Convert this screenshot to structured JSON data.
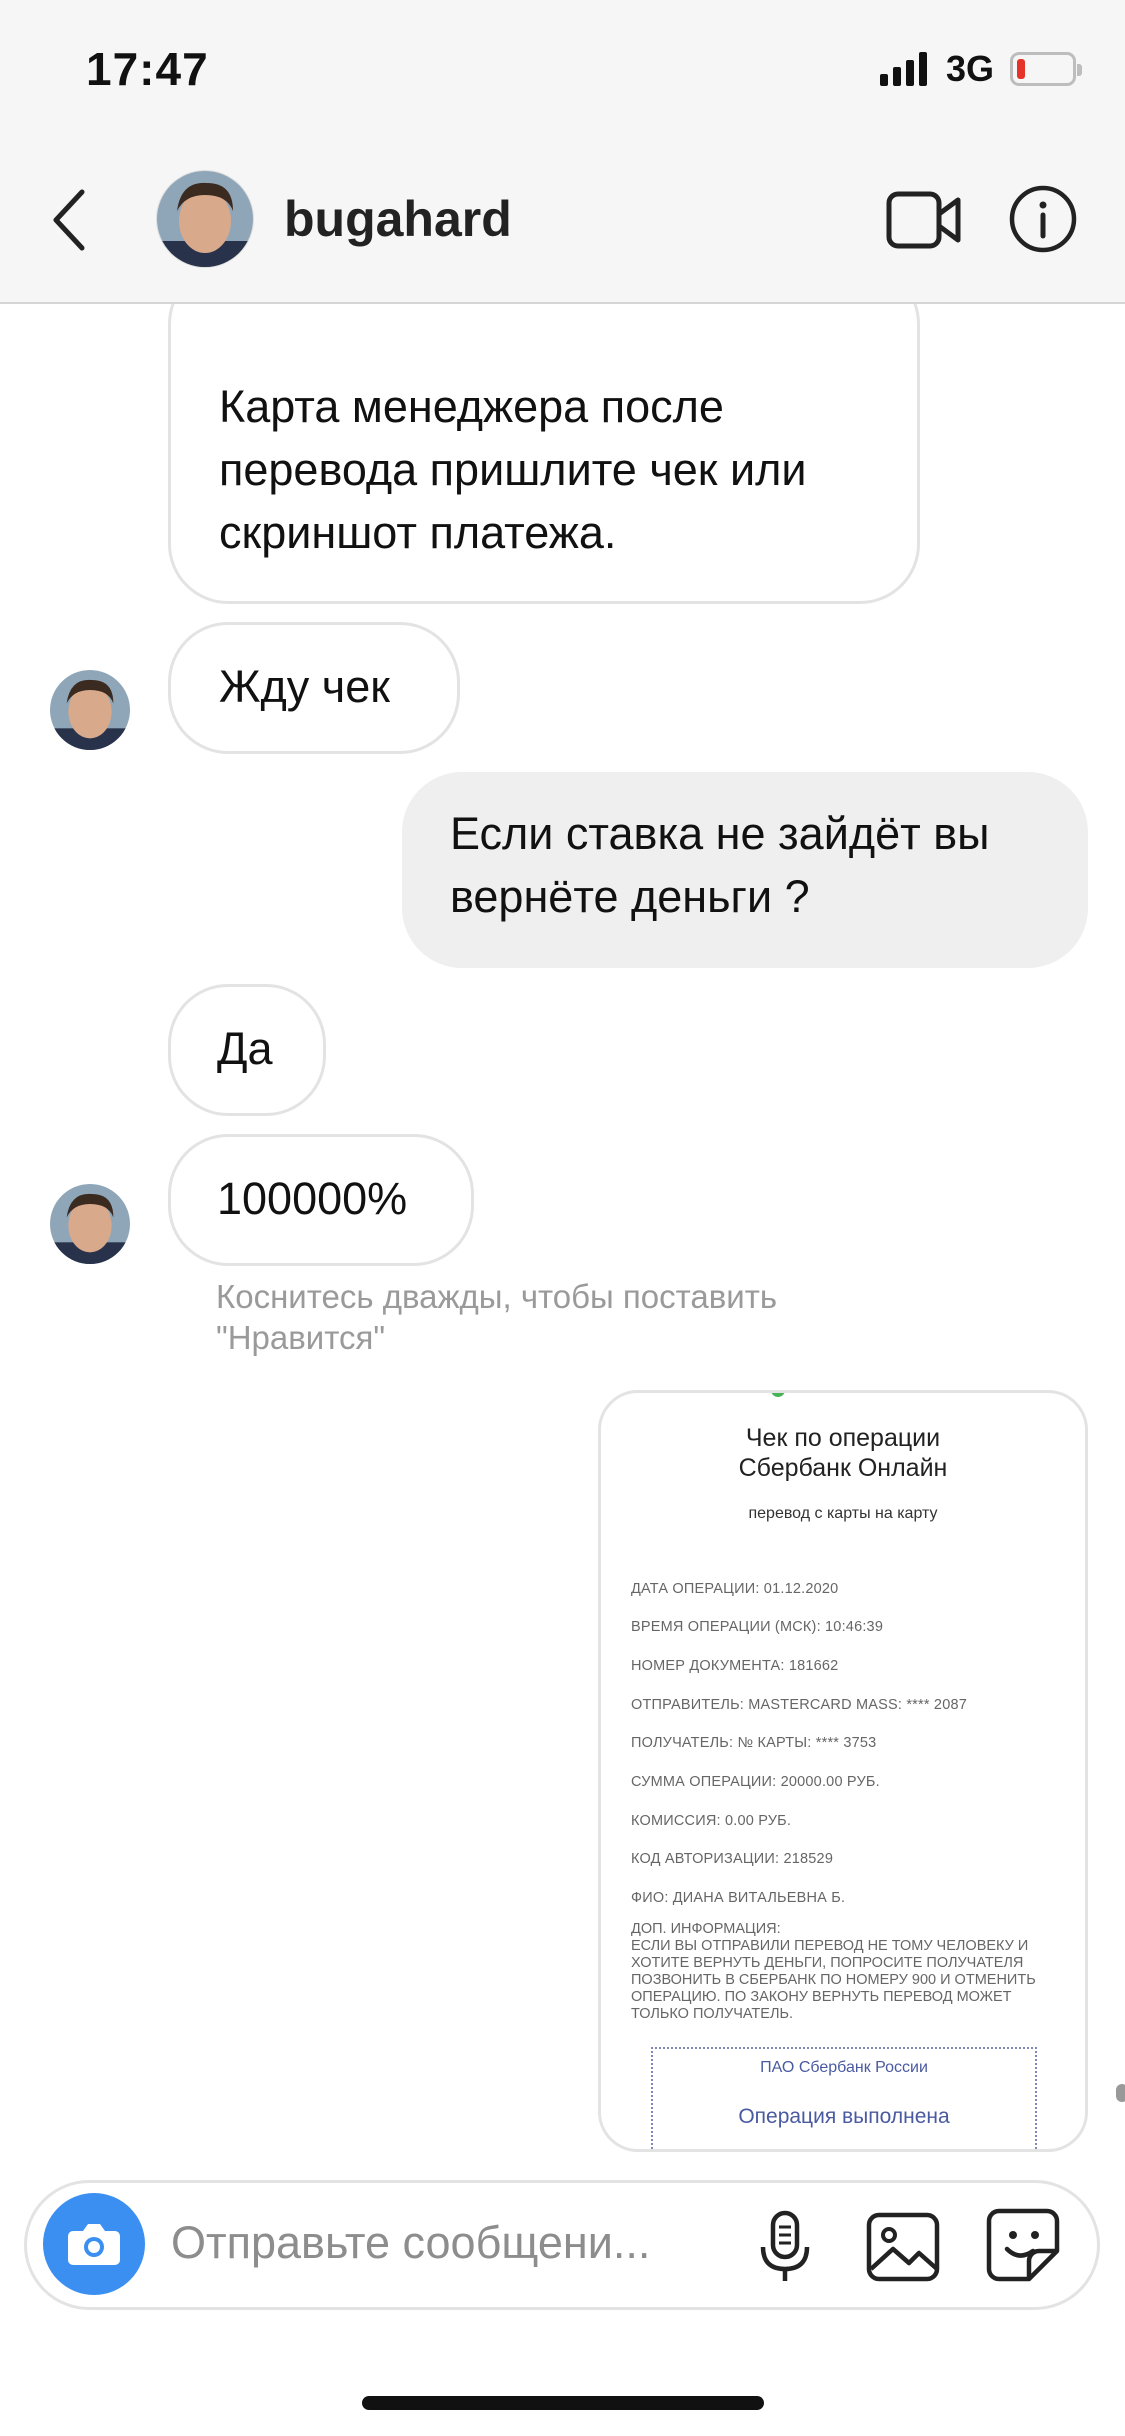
{
  "status_bar": {
    "time": "17:47",
    "network": "3G",
    "battery_level": "low",
    "battery_color": "#e6332a"
  },
  "header": {
    "username": "bugahard",
    "back_icon": "chevron-left-icon",
    "video_icon": "video-camera-icon",
    "info_icon": "info-icon"
  },
  "messages": [
    {
      "direction": "in",
      "text_lines": [
        "Карта менеджера после",
        "перевода пришлите чек или",
        "скриншот платежа."
      ]
    },
    {
      "direction": "in",
      "text": "Жду чек"
    },
    {
      "direction": "out",
      "text_lines": [
        "Если ставка не зайдёт вы",
        "вернёте деньги ?"
      ]
    },
    {
      "direction": "in",
      "text": "Да"
    },
    {
      "direction": "in",
      "text": "100000%"
    }
  ],
  "like_hint": "Коснитесь дважды, чтобы поставить \"Нравится\"",
  "receipt": {
    "title_line1": "Чек по операции",
    "title_line2": "Сбербанк Онлайн",
    "subtitle": "перевод с карты на карту",
    "lines": [
      "ДАТА ОПЕРАЦИИ: 01.12.2020",
      "ВРЕМЯ ОПЕРАЦИИ (МСК): 10:46:39",
      "НОМЕР ДОКУМЕНТА: 181662",
      "ОТПРАВИТЕЛЬ: MASTERCARD MASS: **** 2087",
      "ПОЛУЧАТЕЛЬ: № КАРТЫ: **** 3753",
      "СУММА ОПЕРАЦИИ: 20000.00 РУБ.",
      "КОМИССИЯ: 0.00 РУБ.",
      "КОД АВТОРИЗАЦИИ: 218529",
      "ФИО: ДИАНА ВИТАЛЬЕВНА Б."
    ],
    "note_title": "ДОП. ИНФОРМАЦИЯ:",
    "note_text": "ЕСЛИ ВЫ ОТПРАВИЛИ ПЕРЕВОД НЕ ТОМУ ЧЕЛОВЕКУ И ХОТИТЕ ВЕРНУТЬ ДЕНЬГИ, ПОПРОСИТЕ ПОЛУЧАТЕЛЯ ПОЗВОНИТЬ В СБЕРБАНК ПО НОМЕРУ 900 И ОТМЕНИТЬ ОПЕРАЦИЮ. ПО ЗАКОНУ ВЕРНУТЬ ПЕРЕВОД МОЖЕТ ТОЛЬКО ПОЛУЧАТЕЛЬ.",
    "bank": "ПАО Сбербанк России",
    "status": "Операция выполнена"
  },
  "composer": {
    "placeholder": "Отправьте сообщени...",
    "camera_icon": "camera-icon",
    "mic_icon": "microphone-icon",
    "gallery_icon": "image-icon",
    "sticker_icon": "sticker-icon",
    "accent_color": "#3a8ff0"
  }
}
